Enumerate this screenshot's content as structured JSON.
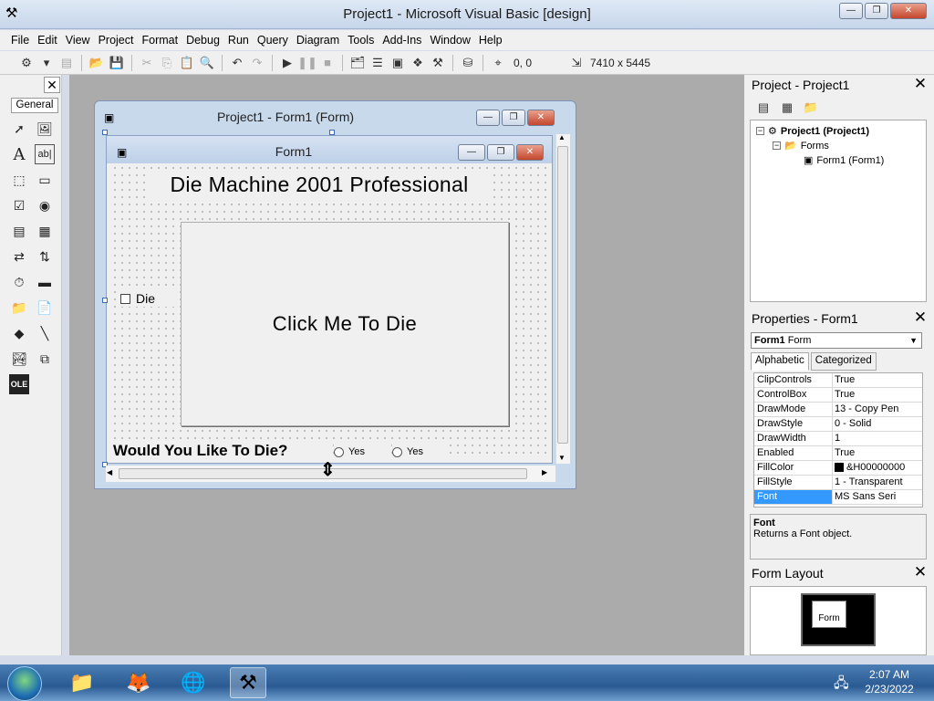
{
  "window": {
    "title": "Project1 - Microsoft Visual Basic [design]"
  },
  "menu": [
    "File",
    "Edit",
    "View",
    "Project",
    "Format",
    "Debug",
    "Run",
    "Query",
    "Diagram",
    "Tools",
    "Add-Ins",
    "Window",
    "Help"
  ],
  "toolbar": {
    "coords": "0, 0",
    "size": "7410 x 5445"
  },
  "toolbox": {
    "tab_label": "General",
    "icons": [
      "pointer-icon",
      "picturebox-icon",
      "label-icon",
      "textbox-icon",
      "frame-icon",
      "commandbutton-icon",
      "checkbox-icon",
      "optionbutton-icon",
      "combobox-icon",
      "listbox-icon",
      "hscrollbar-icon",
      "vscrollbar-icon",
      "timer-icon",
      "drivelistbox-icon",
      "dirlistbox-icon",
      "filelistbox-icon",
      "shape-icon",
      "line-icon",
      "image-icon",
      "data-icon",
      "ole-icon"
    ]
  },
  "designer": {
    "title": "Project1 - Form1 (Form)"
  },
  "form1": {
    "title": "Form1",
    "heading": "Die Machine 2001 Professional",
    "button": "Click Me To Die",
    "checkbox": "Die",
    "question": "Would You Like To Die?",
    "option1": "Yes",
    "option2": "Yes"
  },
  "project_panel": {
    "title": "Project - Project1",
    "root": "Project1 (Project1)",
    "folder": "Forms",
    "item": "Form1 (Form1)"
  },
  "properties_panel": {
    "title": "Properties - Form1",
    "object_bold": "Form1",
    "object_type": "Form",
    "tabs": [
      "Alphabetic",
      "Categorized"
    ],
    "rows": [
      {
        "name": "ClipControls",
        "value": "True"
      },
      {
        "name": "ControlBox",
        "value": "True"
      },
      {
        "name": "DrawMode",
        "value": "13 - Copy Pen"
      },
      {
        "name": "DrawStyle",
        "value": "0 - Solid"
      },
      {
        "name": "DrawWidth",
        "value": "1"
      },
      {
        "name": "Enabled",
        "value": "True"
      },
      {
        "name": "FillColor",
        "value": "&H00000000"
      },
      {
        "name": "FillStyle",
        "value": "1 - Transparent"
      },
      {
        "name": "Font",
        "value": "MS Sans Seri"
      }
    ],
    "desc_title": "Font",
    "desc_text": "Returns a Font object."
  },
  "layout_panel": {
    "title": "Form Layout",
    "mini_form": "Form"
  },
  "taskbar": {
    "time": "2:07 AM",
    "date": "2/23/2022"
  }
}
